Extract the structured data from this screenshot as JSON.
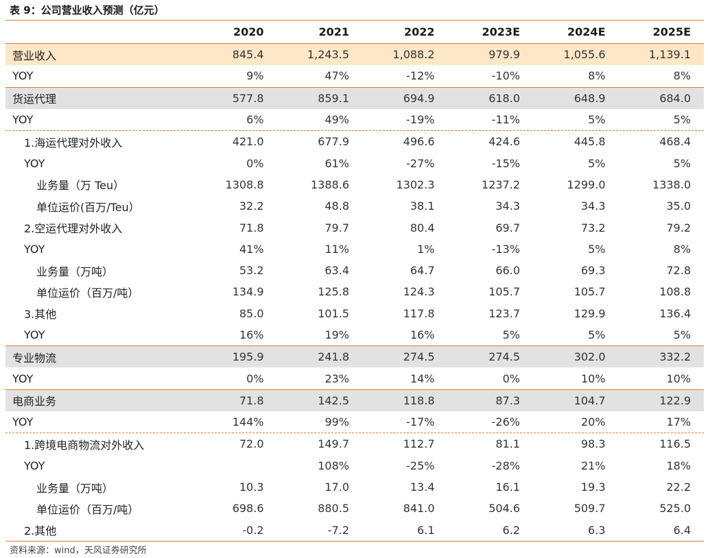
{
  "title": "表 9：公司营业收入预测（亿元）",
  "header": [
    "",
    "2020",
    "2021",
    "2022",
    "2023E",
    "2024E",
    "2025E"
  ],
  "rows": [
    {
      "label": "营业收入",
      "values": [
        "845.4",
        "1,243.5",
        "1,088.2",
        "979.9",
        "1,055.6",
        "1,139.1"
      ],
      "style": "orange",
      "level": 0,
      "sep": "solid"
    },
    {
      "label": "YOY",
      "values": [
        "9%",
        "47%",
        "-12%",
        "-10%",
        "8%",
        "8%"
      ],
      "style": "",
      "level": 0,
      "sep": ""
    },
    {
      "label": "货运代理",
      "values": [
        "577.8",
        "859.1",
        "694.9",
        "618.0",
        "648.9",
        "684.0"
      ],
      "style": "gray",
      "level": 0,
      "sep": "solid"
    },
    {
      "label": "YOY",
      "values": [
        "6%",
        "49%",
        "-19%",
        "-11%",
        "5%",
        "5%"
      ],
      "style": "",
      "level": 0,
      "sep": ""
    },
    {
      "label": "1.海运代理对外收入",
      "values": [
        "421.0",
        "677.9",
        "496.6",
        "424.6",
        "445.8",
        "468.4"
      ],
      "style": "",
      "level": 1,
      "sep": "dash"
    },
    {
      "label": "YOY",
      "values": [
        "0%",
        "61%",
        "-27%",
        "-15%",
        "5%",
        "5%"
      ],
      "style": "",
      "level": 1,
      "sep": ""
    },
    {
      "label": "业务量（万 Teu）",
      "values": [
        "1308.8",
        "1388.6",
        "1302.3",
        "1237.2",
        "1299.0",
        "1338.0"
      ],
      "style": "",
      "level": 2,
      "sep": ""
    },
    {
      "label": "单位运价(百万/Teu）",
      "values": [
        "32.2",
        "48.8",
        "38.1",
        "34.3",
        "34.3",
        "35.0"
      ],
      "style": "",
      "level": 2,
      "sep": ""
    },
    {
      "label": "2.空运代理对外收入",
      "values": [
        "71.8",
        "79.7",
        "80.4",
        "69.7",
        "73.2",
        "79.2"
      ],
      "style": "",
      "level": 1,
      "sep": ""
    },
    {
      "label": "YOY",
      "values": [
        "41%",
        "11%",
        "1%",
        "-13%",
        "5%",
        "8%"
      ],
      "style": "",
      "level": 1,
      "sep": ""
    },
    {
      "label": "业务量（万吨）",
      "values": [
        "53.2",
        "63.4",
        "64.7",
        "66.0",
        "69.3",
        "72.8"
      ],
      "style": "",
      "level": 2,
      "sep": ""
    },
    {
      "label": "单位运价（百万/吨）",
      "values": [
        "134.9",
        "125.8",
        "124.3",
        "105.7",
        "105.7",
        "108.8"
      ],
      "style": "",
      "level": 2,
      "sep": ""
    },
    {
      "label": "3.其他",
      "values": [
        "85.0",
        "101.5",
        "117.8",
        "123.7",
        "129.9",
        "136.4"
      ],
      "style": "",
      "level": 1,
      "sep": ""
    },
    {
      "label": "YOY",
      "values": [
        "16%",
        "19%",
        "16%",
        "5%",
        "5%",
        "5%"
      ],
      "style": "",
      "level": 1,
      "sep": ""
    },
    {
      "label": "专业物流",
      "values": [
        "195.9",
        "241.8",
        "274.5",
        "274.5",
        "302.0",
        "332.2"
      ],
      "style": "gray",
      "level": 0,
      "sep": "solid"
    },
    {
      "label": "YOY",
      "values": [
        "0%",
        "23%",
        "14%",
        "0%",
        "10%",
        "10%"
      ],
      "style": "",
      "level": 0,
      "sep": ""
    },
    {
      "label": "电商业务",
      "values": [
        "71.8",
        "142.5",
        "118.8",
        "87.3",
        "104.7",
        "122.9"
      ],
      "style": "gray",
      "level": 0,
      "sep": "solid"
    },
    {
      "label": "YOY",
      "values": [
        "144%",
        "99%",
        "-17%",
        "-26%",
        "20%",
        "17%"
      ],
      "style": "",
      "level": 0,
      "sep": ""
    },
    {
      "label": "1.跨境电商物流对外收入",
      "values": [
        "72.0",
        "149.7",
        "112.7",
        "81.1",
        "98.3",
        "116.5"
      ],
      "style": "",
      "level": 1,
      "sep": "dash"
    },
    {
      "label": "YOY",
      "values": [
        "",
        "108%",
        "-25%",
        "-28%",
        "21%",
        "18%"
      ],
      "style": "",
      "level": 1,
      "sep": ""
    },
    {
      "label": "业务量（万吨）",
      "values": [
        "10.3",
        "17.0",
        "13.4",
        "16.1",
        "19.3",
        "22.2"
      ],
      "style": "",
      "level": 2,
      "sep": ""
    },
    {
      "label": "单位运价（百万/吨）",
      "values": [
        "698.6",
        "880.5",
        "841.0",
        "504.6",
        "509.7",
        "525.0"
      ],
      "style": "",
      "level": 2,
      "sep": ""
    },
    {
      "label": "2.其他",
      "values": [
        "-0.2",
        "-7.2",
        "6.1",
        "6.2",
        "6.3",
        "6.4"
      ],
      "style": "",
      "level": 1,
      "sep": ""
    }
  ],
  "source": "资料来源：wind，天风证券研究所",
  "colors": {
    "accent_line": "#e07a2e",
    "highlight_orange": "#fde7c7",
    "highlight_gray": "#e2e2e2"
  }
}
